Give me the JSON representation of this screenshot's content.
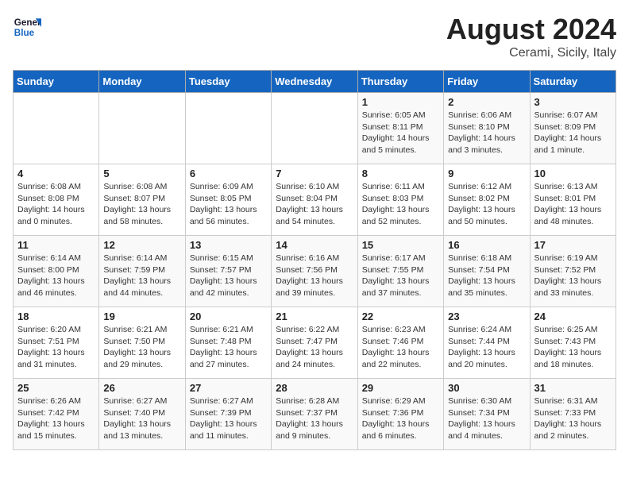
{
  "logo": {
    "text_general": "General",
    "text_blue": "Blue"
  },
  "header": {
    "title": "August 2024",
    "subtitle": "Cerami, Sicily, Italy"
  },
  "days_of_week": [
    "Sunday",
    "Monday",
    "Tuesday",
    "Wednesday",
    "Thursday",
    "Friday",
    "Saturday"
  ],
  "weeks": [
    [
      {
        "day": "",
        "info": ""
      },
      {
        "day": "",
        "info": ""
      },
      {
        "day": "",
        "info": ""
      },
      {
        "day": "",
        "info": ""
      },
      {
        "day": "1",
        "info": "Sunrise: 6:05 AM\nSunset: 8:11 PM\nDaylight: 14 hours\nand 5 minutes."
      },
      {
        "day": "2",
        "info": "Sunrise: 6:06 AM\nSunset: 8:10 PM\nDaylight: 14 hours\nand 3 minutes."
      },
      {
        "day": "3",
        "info": "Sunrise: 6:07 AM\nSunset: 8:09 PM\nDaylight: 14 hours\nand 1 minute."
      }
    ],
    [
      {
        "day": "4",
        "info": "Sunrise: 6:08 AM\nSunset: 8:08 PM\nDaylight: 14 hours\nand 0 minutes."
      },
      {
        "day": "5",
        "info": "Sunrise: 6:08 AM\nSunset: 8:07 PM\nDaylight: 13 hours\nand 58 minutes."
      },
      {
        "day": "6",
        "info": "Sunrise: 6:09 AM\nSunset: 8:05 PM\nDaylight: 13 hours\nand 56 minutes."
      },
      {
        "day": "7",
        "info": "Sunrise: 6:10 AM\nSunset: 8:04 PM\nDaylight: 13 hours\nand 54 minutes."
      },
      {
        "day": "8",
        "info": "Sunrise: 6:11 AM\nSunset: 8:03 PM\nDaylight: 13 hours\nand 52 minutes."
      },
      {
        "day": "9",
        "info": "Sunrise: 6:12 AM\nSunset: 8:02 PM\nDaylight: 13 hours\nand 50 minutes."
      },
      {
        "day": "10",
        "info": "Sunrise: 6:13 AM\nSunset: 8:01 PM\nDaylight: 13 hours\nand 48 minutes."
      }
    ],
    [
      {
        "day": "11",
        "info": "Sunrise: 6:14 AM\nSunset: 8:00 PM\nDaylight: 13 hours\nand 46 minutes."
      },
      {
        "day": "12",
        "info": "Sunrise: 6:14 AM\nSunset: 7:59 PM\nDaylight: 13 hours\nand 44 minutes."
      },
      {
        "day": "13",
        "info": "Sunrise: 6:15 AM\nSunset: 7:57 PM\nDaylight: 13 hours\nand 42 minutes."
      },
      {
        "day": "14",
        "info": "Sunrise: 6:16 AM\nSunset: 7:56 PM\nDaylight: 13 hours\nand 39 minutes."
      },
      {
        "day": "15",
        "info": "Sunrise: 6:17 AM\nSunset: 7:55 PM\nDaylight: 13 hours\nand 37 minutes."
      },
      {
        "day": "16",
        "info": "Sunrise: 6:18 AM\nSunset: 7:54 PM\nDaylight: 13 hours\nand 35 minutes."
      },
      {
        "day": "17",
        "info": "Sunrise: 6:19 AM\nSunset: 7:52 PM\nDaylight: 13 hours\nand 33 minutes."
      }
    ],
    [
      {
        "day": "18",
        "info": "Sunrise: 6:20 AM\nSunset: 7:51 PM\nDaylight: 13 hours\nand 31 minutes."
      },
      {
        "day": "19",
        "info": "Sunrise: 6:21 AM\nSunset: 7:50 PM\nDaylight: 13 hours\nand 29 minutes."
      },
      {
        "day": "20",
        "info": "Sunrise: 6:21 AM\nSunset: 7:48 PM\nDaylight: 13 hours\nand 27 minutes."
      },
      {
        "day": "21",
        "info": "Sunrise: 6:22 AM\nSunset: 7:47 PM\nDaylight: 13 hours\nand 24 minutes."
      },
      {
        "day": "22",
        "info": "Sunrise: 6:23 AM\nSunset: 7:46 PM\nDaylight: 13 hours\nand 22 minutes."
      },
      {
        "day": "23",
        "info": "Sunrise: 6:24 AM\nSunset: 7:44 PM\nDaylight: 13 hours\nand 20 minutes."
      },
      {
        "day": "24",
        "info": "Sunrise: 6:25 AM\nSunset: 7:43 PM\nDaylight: 13 hours\nand 18 minutes."
      }
    ],
    [
      {
        "day": "25",
        "info": "Sunrise: 6:26 AM\nSunset: 7:42 PM\nDaylight: 13 hours\nand 15 minutes."
      },
      {
        "day": "26",
        "info": "Sunrise: 6:27 AM\nSunset: 7:40 PM\nDaylight: 13 hours\nand 13 minutes."
      },
      {
        "day": "27",
        "info": "Sunrise: 6:27 AM\nSunset: 7:39 PM\nDaylight: 13 hours\nand 11 minutes."
      },
      {
        "day": "28",
        "info": "Sunrise: 6:28 AM\nSunset: 7:37 PM\nDaylight: 13 hours\nand 9 minutes."
      },
      {
        "day": "29",
        "info": "Sunrise: 6:29 AM\nSunset: 7:36 PM\nDaylight: 13 hours\nand 6 minutes."
      },
      {
        "day": "30",
        "info": "Sunrise: 6:30 AM\nSunset: 7:34 PM\nDaylight: 13 hours\nand 4 minutes."
      },
      {
        "day": "31",
        "info": "Sunrise: 6:31 AM\nSunset: 7:33 PM\nDaylight: 13 hours\nand 2 minutes."
      }
    ]
  ]
}
